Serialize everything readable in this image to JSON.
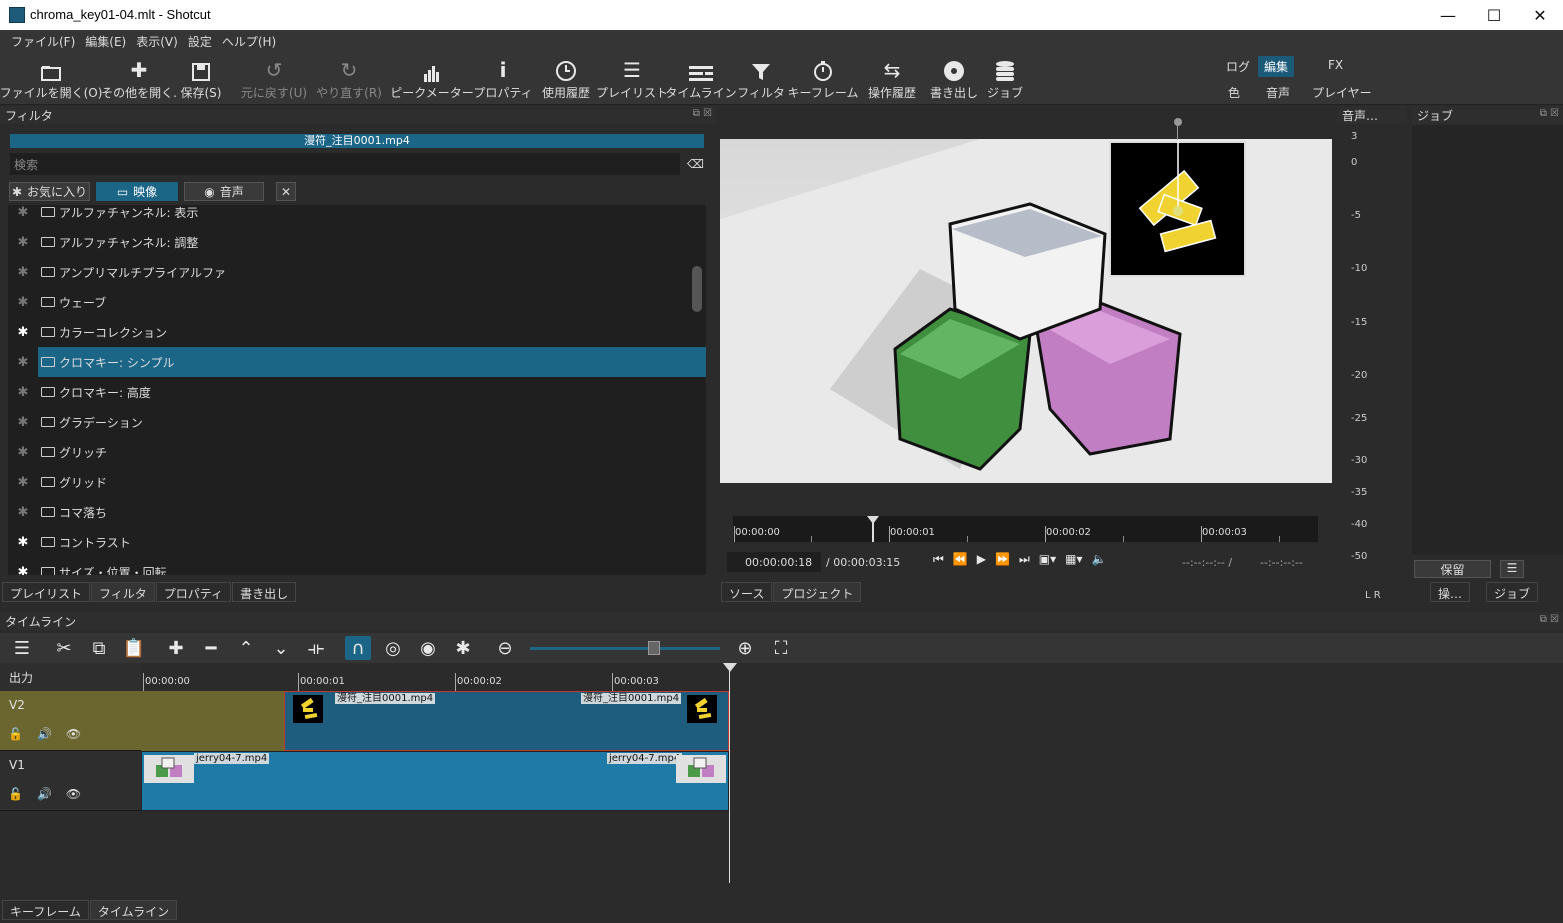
{
  "window": {
    "title": "chroma_key01-04.mlt - Shotcut",
    "min": "—",
    "max": "☐",
    "close": "✕"
  },
  "menu": [
    "ファイル(F)",
    "編集(E)",
    "表示(V)",
    "設定",
    "ヘルプ(H)"
  ],
  "toolbar": [
    {
      "label": "ファイルを開く(O)",
      "icon": "folder-open-icon"
    },
    {
      "label": "その他を開く.",
      "icon": "open-other-icon"
    },
    {
      "label": "保存(S)",
      "icon": "save-icon"
    },
    {
      "label": "元に戻す(U)",
      "icon": "undo-icon"
    },
    {
      "label": "やり直す(R)",
      "icon": "redo-icon"
    },
    {
      "label": "ピークメーター",
      "icon": "peak-meter-icon"
    },
    {
      "label": "プロパティ",
      "icon": "info-icon"
    },
    {
      "label": "使用履歴",
      "icon": "clock-icon"
    },
    {
      "label": "プレイリスト",
      "icon": "list-icon"
    },
    {
      "label": "タイムライン",
      "icon": "timeline-icon"
    },
    {
      "label": "フィルタ",
      "icon": "filter-icon"
    },
    {
      "label": "キーフレーム",
      "icon": "stopwatch-icon"
    },
    {
      "label": "操作履歴",
      "icon": "history-icon"
    },
    {
      "label": "書き出し",
      "icon": "disc-icon"
    },
    {
      "label": "ジョブ",
      "icon": "database-icon"
    }
  ],
  "layouts": {
    "log": "ログ",
    "edit": "編集",
    "fx": "FX",
    "color": "色",
    "audio": "音声",
    "player": "プレイヤー"
  },
  "filters_panel": {
    "header": "フィルタ",
    "clip": "漫符_注目0001.mp4",
    "search_placeholder": "検索",
    "chips": {
      "favorites": "お気に入り",
      "video": "映像",
      "audio": "音声"
    },
    "items": [
      {
        "name": "アルファチャンネル: 表示",
        "fav": false
      },
      {
        "name": "アルファチャンネル: 調整",
        "fav": false
      },
      {
        "name": "アンプリマルチプライアルファ",
        "fav": false
      },
      {
        "name": "ウェーブ",
        "fav": false
      },
      {
        "name": "カラーコレクション",
        "fav": true
      },
      {
        "name": "クロマキー: シンプル",
        "fav": false,
        "selected": true
      },
      {
        "name": "クロマキー: 高度",
        "fav": false
      },
      {
        "name": "グラデーション",
        "fav": false
      },
      {
        "name": "グリッチ",
        "fav": false
      },
      {
        "name": "グリッド",
        "fav": false
      },
      {
        "name": "コマ落ち",
        "fav": false
      },
      {
        "name": "コントラスト",
        "fav": true
      },
      {
        "name": "サイズ・位置・回転",
        "fav": true
      }
    ],
    "tabs": [
      "プレイリスト",
      "フィルタ",
      "プロパティ",
      "書き出し"
    ]
  },
  "player": {
    "ruler_labels": [
      "00:00:00",
      "00:00:01",
      "00:00:02",
      "00:00:03"
    ],
    "position": "00:00:00:18",
    "duration": "/ 00:00:03:15",
    "in_point": "--:--:--:-- /",
    "out_point": "--:--:--:--",
    "tabs": [
      "ソース",
      "プロジェクト"
    ]
  },
  "audio_meter": {
    "header": "音声…",
    "scale": [
      "3",
      "0",
      "-5",
      "-10",
      "-15",
      "-20",
      "-25",
      "-30",
      "-35",
      "-40",
      "-50"
    ],
    "lr": "L R"
  },
  "jobs": {
    "header": "ジョブ",
    "pause": "保留",
    "tab_ops": "操…",
    "tab_jobs": "ジョブ"
  },
  "timeline": {
    "header": "タイムライン",
    "output": "出力",
    "ruler": [
      "00:00:00",
      "00:00:01",
      "00:00:02",
      "00:00:03"
    ],
    "tracks": [
      {
        "name": "V2",
        "clip_start": "漫符_注目0001.mp4",
        "clip_end": "漫符_注目0001.mp4"
      },
      {
        "name": "V1",
        "clip_start": "jerry04-7.mp4",
        "clip_end": "jerry04-7.mp4"
      }
    ]
  },
  "bottom_tabs": [
    "キーフレーム",
    "タイムライン"
  ],
  "colors": {
    "accent": "#1b6587",
    "clip": "#1e7aa6",
    "v2_gap": "#6b6630"
  }
}
